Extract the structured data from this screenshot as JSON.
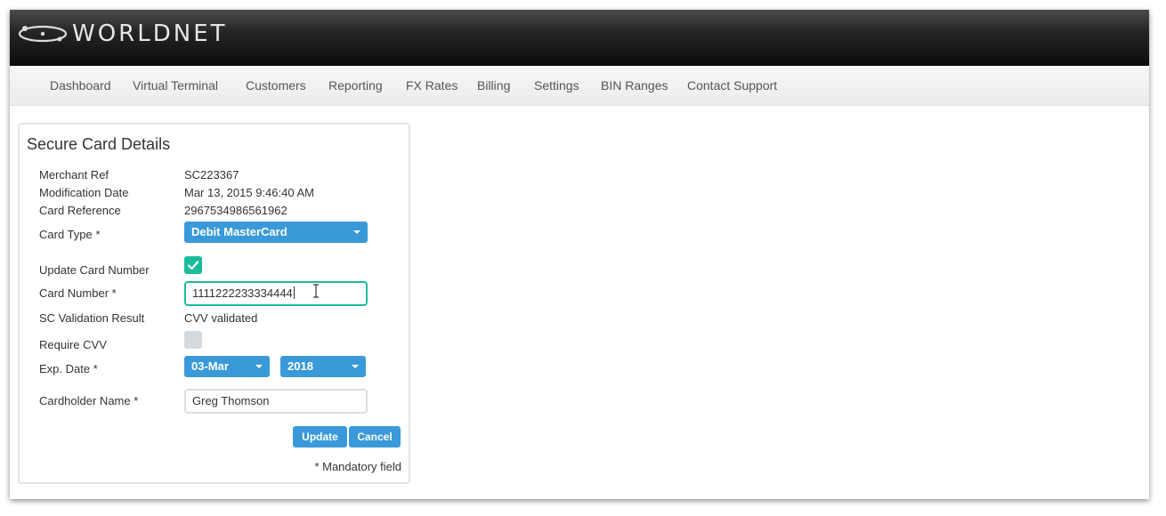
{
  "brand": {
    "name": "WORLDNET",
    "logo_icon": "orbit-logo-icon"
  },
  "nav": {
    "items": [
      {
        "label": "Dashboard"
      },
      {
        "label": "Virtual Terminal"
      },
      {
        "label": "Customers"
      },
      {
        "label": "Reporting"
      },
      {
        "label": "FX Rates"
      },
      {
        "label": "Billing"
      },
      {
        "label": "Settings"
      },
      {
        "label": "BIN Ranges"
      },
      {
        "label": "Contact Support"
      }
    ]
  },
  "panel": {
    "title": "Secure Card Details",
    "fields": {
      "merchant_ref": {
        "label": "Merchant Ref",
        "value": "SC223367"
      },
      "modification_date": {
        "label": "Modification Date",
        "value": "Mar 13, 2015 9:46:40 AM"
      },
      "card_reference": {
        "label": "Card Reference",
        "value": "2967534986561962"
      },
      "card_type": {
        "label": "Card Type *",
        "value": "Debit MasterCard"
      },
      "update_card_number": {
        "label": "Update Card Number",
        "checked": true
      },
      "card_number": {
        "label": "Card Number *",
        "value": "1111222233334444"
      },
      "sc_validation": {
        "label": "SC Validation Result",
        "value": "CVV validated"
      },
      "require_cvv": {
        "label": "Require CVV",
        "checked": false
      },
      "exp_date": {
        "label": "Exp. Date *",
        "month": "03-Mar",
        "year": "2018"
      },
      "cardholder_name": {
        "label": "Cardholder Name *",
        "value": "Greg Thomson"
      }
    },
    "buttons": {
      "update": "Update",
      "cancel": "Cancel"
    },
    "mandatory_note": "* Mandatory field"
  },
  "colors": {
    "accent_blue": "#3a9ad9",
    "accent_green": "#1abc9c",
    "topbar": "#111111",
    "navbar": "#f2f2f2"
  }
}
